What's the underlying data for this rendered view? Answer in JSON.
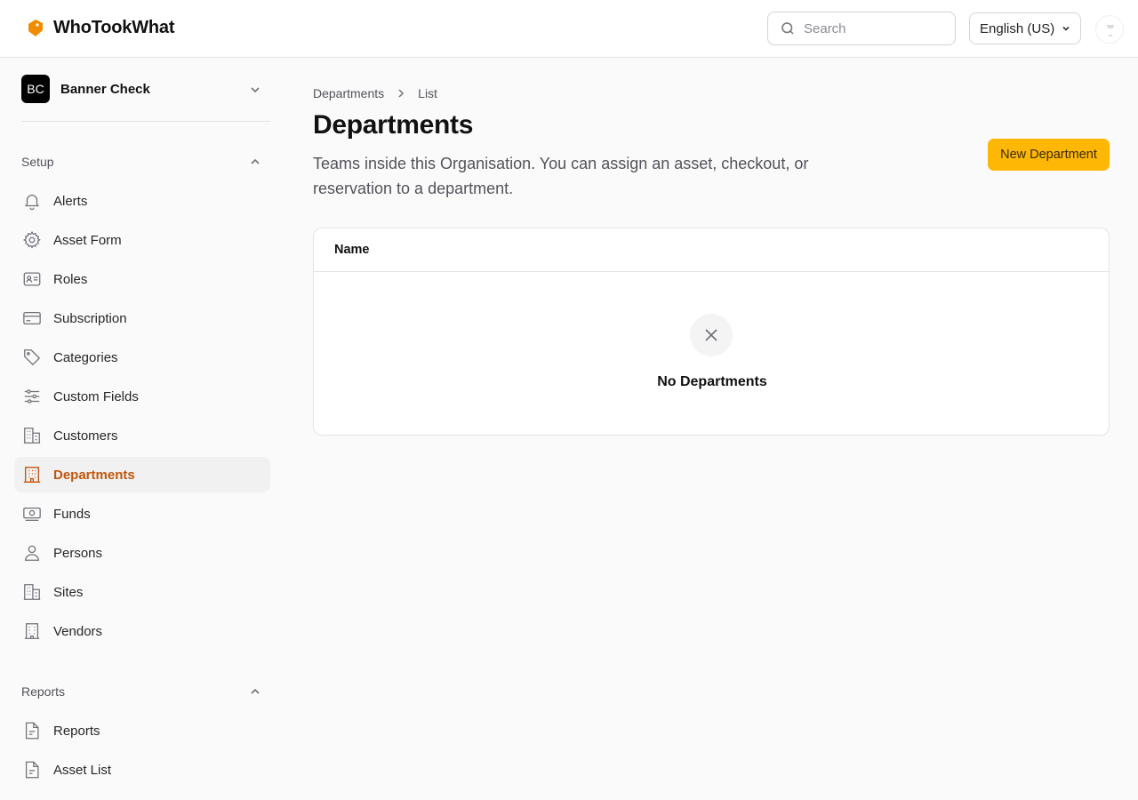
{
  "header": {
    "app_name": "WhoTookWhat",
    "search_placeholder": "Search",
    "language": "English (US)"
  },
  "sidebar": {
    "org": {
      "initials": "BC",
      "name": "Banner Check"
    },
    "setup": {
      "title": "Setup",
      "items": [
        {
          "label": "Alerts",
          "icon": "bell-icon"
        },
        {
          "label": "Asset Form",
          "icon": "gear-icon"
        },
        {
          "label": "Roles",
          "icon": "id-card-icon"
        },
        {
          "label": "Subscription",
          "icon": "credit-card-icon"
        },
        {
          "label": "Categories",
          "icon": "tag-icon"
        },
        {
          "label": "Custom Fields",
          "icon": "sliders-icon"
        },
        {
          "label": "Customers",
          "icon": "building-icon"
        },
        {
          "label": "Departments",
          "icon": "office-building-icon",
          "active": true
        },
        {
          "label": "Funds",
          "icon": "banknote-icon"
        },
        {
          "label": "Persons",
          "icon": "user-icon"
        },
        {
          "label": "Sites",
          "icon": "buildings-icon"
        },
        {
          "label": "Vendors",
          "icon": "building-icon"
        }
      ]
    },
    "reports": {
      "title": "Reports",
      "items": [
        {
          "label": "Reports",
          "icon": "document-icon"
        },
        {
          "label": "Asset List",
          "icon": "document-icon"
        }
      ]
    }
  },
  "main": {
    "breadcrumb": [
      "Departments",
      "List"
    ],
    "title": "Departments",
    "description": "Teams inside this Organisation. You can assign an asset, checkout, or reservation to a department.",
    "new_button": "New Department",
    "table": {
      "columns": [
        "Name"
      ],
      "empty_text": "No Departments"
    }
  },
  "colors": {
    "accent": "#fdb704",
    "active_text": "#c2570c",
    "logo": "#f08c00"
  }
}
